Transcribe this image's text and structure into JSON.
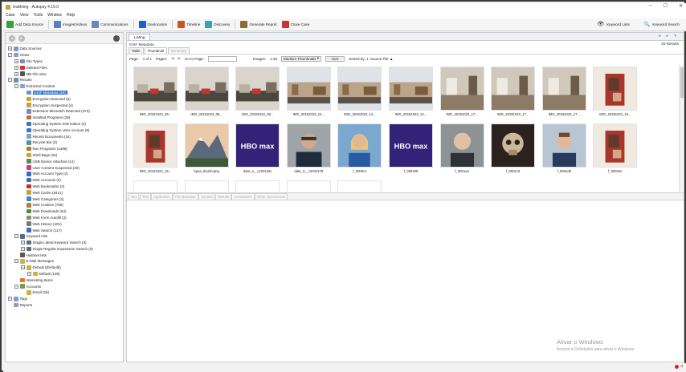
{
  "window": {
    "title": "leakkiing - Autopsy 4.19.0",
    "min": "–",
    "max": "☐",
    "close": "✕"
  },
  "menu": [
    "Case",
    "View",
    "Tools",
    "Window",
    "Help"
  ],
  "toolbar": {
    "items": [
      {
        "label": "Add Data Source",
        "icon": "plus-icon",
        "color": "#3aa13a"
      },
      {
        "label": "Images/Videos",
        "icon": "images-icon",
        "color": "#5b7fc0"
      },
      {
        "label": "Communications",
        "icon": "communications-icon",
        "color": "#6a88b8"
      },
      {
        "label": "Geolocation",
        "icon": "geolocation-icon",
        "color": "#2060c8"
      },
      {
        "label": "Timeline",
        "icon": "timeline-icon",
        "color": "#d0502a"
      },
      {
        "label": "Discovery",
        "icon": "discovery-icon",
        "color": "#3aa0b8"
      },
      {
        "label": "Generate Report",
        "icon": "report-icon",
        "color": "#8a6c3a"
      },
      {
        "label": "Close Case",
        "icon": "close-case-icon",
        "color": "#cc3333"
      }
    ],
    "keyword_lists": "Keyword Lists",
    "keyword_search": "Keyword Search"
  },
  "tree": [
    {
      "label": "Data Sources",
      "level": 0,
      "exp": "+",
      "icon": "#7a9cc8"
    },
    {
      "label": "Views",
      "level": 0,
      "exp": "−",
      "icon": "#8aa0c0"
    },
    {
      "label": "File Types",
      "level": 1,
      "exp": "+",
      "icon": "#7a8fb8"
    },
    {
      "label": "Deleted Files",
      "level": 1,
      "exp": "+",
      "icon": "#cc3333"
    },
    {
      "label": "MB File Size",
      "level": 1,
      "exp": "+",
      "icon": "#555555"
    },
    {
      "label": "Results",
      "level": 0,
      "exp": "−",
      "icon": "#6b8ab8"
    },
    {
      "label": "Extracted Content",
      "level": 1,
      "exp": "−",
      "icon": "#8aa0c0"
    },
    {
      "label": "EXIF Metadata (25)",
      "level": 2,
      "exp": "",
      "icon": "#6a93d6",
      "selected": true
    },
    {
      "label": "Encryption Detected (6)",
      "level": 2,
      "exp": "",
      "icon": "#d0a030"
    },
    {
      "label": "Encryption Suspected (4)",
      "level": 2,
      "exp": "",
      "icon": "#d0a030"
    },
    {
      "label": "Extension Mismatch Detected (373)",
      "level": 2,
      "exp": "",
      "icon": "#6f8fbf"
    },
    {
      "label": "Installed Programs (29)",
      "level": 2,
      "exp": "",
      "icon": "#c07030"
    },
    {
      "label": "Operating System Information (2)",
      "level": 2,
      "exp": "",
      "icon": "#3b74c8"
    },
    {
      "label": "Operating System User Account (8)",
      "level": 2,
      "exp": "",
      "icon": "#3b74c8"
    },
    {
      "label": "Recent Documents (24)",
      "level": 2,
      "exp": "",
      "icon": "#8aa0c0"
    },
    {
      "label": "Recycle Bin (3)",
      "level": 2,
      "exp": "",
      "icon": "#3aa0a0"
    },
    {
      "label": "Run Programs (1486)",
      "level": 2,
      "exp": "",
      "icon": "#c07030"
    },
    {
      "label": "Shell Bags (26)",
      "level": 2,
      "exp": "",
      "icon": "#d0a030"
    },
    {
      "label": "USB Device Attached (14)",
      "level": 2,
      "exp": "",
      "icon": "#5a8a5a"
    },
    {
      "label": "User Content Suspected (20)",
      "level": 2,
      "exp": "",
      "icon": "#c04080"
    },
    {
      "label": "Web Account Type (2)",
      "level": 2,
      "exp": "",
      "icon": "#3a6ac0"
    },
    {
      "label": "Web Accounts (2)",
      "level": 2,
      "exp": "",
      "icon": "#3a6ac0"
    },
    {
      "label": "Web Bookmarks (3)",
      "level": 2,
      "exp": "",
      "icon": "#c03030"
    },
    {
      "label": "Web Cache (8411)",
      "level": 2,
      "exp": "",
      "icon": "#d0a030"
    },
    {
      "label": "Web Categories (2)",
      "level": 2,
      "exp": "",
      "icon": "#3a8ad0"
    },
    {
      "label": "Web Cookies (786)",
      "level": 2,
      "exp": "",
      "icon": "#b08040"
    },
    {
      "label": "Web Downloads (54)",
      "level": 2,
      "exp": "",
      "icon": "#3a9a3a"
    },
    {
      "label": "Web Form Autofill (3)",
      "level": 2,
      "exp": "",
      "icon": "#8a8a8a"
    },
    {
      "label": "Web History (401)",
      "level": 2,
      "exp": "",
      "icon": "#7a7a7a"
    },
    {
      "label": "Web Search (117)",
      "level": 2,
      "exp": "",
      "icon": "#3a6ad0"
    },
    {
      "label": "Keyword Hits",
      "level": 1,
      "exp": "−",
      "icon": "#5a6a8a"
    },
    {
      "label": "Single Literal Keyword Search (0)",
      "level": 2,
      "exp": "+",
      "icon": "#5a6a8a"
    },
    {
      "label": "Single Regular Expression Search (0)",
      "level": 2,
      "exp": "+",
      "icon": "#5a6a8a"
    },
    {
      "label": "Hashset Hits",
      "level": 1,
      "exp": "",
      "icon": "#5a5a5a"
    },
    {
      "label": "E-Mail Messages",
      "level": 1,
      "exp": "−",
      "icon": "#d0b040"
    },
    {
      "label": "Default ([Default])",
      "level": 2,
      "exp": "−",
      "icon": "#d0b040"
    },
    {
      "label": "Default (138)",
      "level": 3,
      "exp": "+",
      "icon": "#d0b040"
    },
    {
      "label": "Interesting Items",
      "level": 1,
      "exp": "",
      "icon": "#e07a20"
    },
    {
      "label": "Accounts",
      "level": 1,
      "exp": "−",
      "icon": "#7a9a4a"
    },
    {
      "label": "Email (26)",
      "level": 2,
      "exp": "",
      "icon": "#d0b040"
    },
    {
      "label": "Tags",
      "level": 0,
      "exp": "+",
      "icon": "#7a9cc8"
    },
    {
      "label": "Reports",
      "level": 0,
      "exp": "",
      "icon": "#8aa0c0"
    }
  ],
  "main": {
    "top_tab": "Listing",
    "tab_controls": "◂ ▸ ▾",
    "section": "EXIF Metadata",
    "result_count": "25 Results",
    "view_tabs": [
      {
        "label": "Table",
        "active": false,
        "disabled": false
      },
      {
        "label": "Thumbnail",
        "active": true,
        "disabled": false
      },
      {
        "label": "Summary",
        "active": false,
        "disabled": true
      }
    ],
    "pager": {
      "page_label": "Page:",
      "page_value": "1 of 1",
      "pages_label": "Pages:",
      "go_label": "Go to Page:",
      "images_label": "Images:",
      "images_value": "1-25",
      "thumb_size": "Medium Thumbnails",
      "sort_button": "Sort",
      "sorted_by": "Sorted by: 1. Source File ▲"
    },
    "thumbnails": [
      {
        "name": "IMG_20191023_09...",
        "kind": "street"
      },
      {
        "name": "IMG_20191023_09...",
        "kind": "street"
      },
      {
        "name": "IMG_20191023_09...",
        "kind": "street"
      },
      {
        "name": "IMG_20191023_14...",
        "kind": "plaza"
      },
      {
        "name": "IMG_20191023_14...",
        "kind": "plaza"
      },
      {
        "name": "IMG_20191023_14...",
        "kind": "plaza"
      },
      {
        "name": "IMG_20191023_17...",
        "kind": "room"
      },
      {
        "name": "IMG_20191023_17...",
        "kind": "room"
      },
      {
        "name": "IMG_20191023_17...",
        "kind": "room"
      },
      {
        "name": "IMG_20191024_15...",
        "kind": "portrait-red"
      },
      {
        "name": "IMG_20191024_15...",
        "kind": "portrait-red"
      },
      {
        "name": "bg1a_thumb.png",
        "kind": "mountain"
      },
      {
        "name": "data_3__c103146c",
        "kind": "hbomax"
      },
      {
        "name": "data_3__c2031478",
        "kind": "man-suit"
      },
      {
        "name": "f_0000c1",
        "kind": "woman-blue"
      },
      {
        "name": "f_000198",
        "kind": "hbomax"
      },
      {
        "name": "f_0001a4",
        "kind": "bald-man"
      },
      {
        "name": "f_0001c9",
        "kind": "skull"
      },
      {
        "name": "f_0001d9",
        "kind": "man-red"
      },
      {
        "name": "f_00022e",
        "kind": "portrait-red"
      }
    ],
    "lower_tabs": [
      "Hex",
      "Text",
      "Application",
      "File Metadata",
      "Context",
      "Results",
      "Annotations",
      "Other Occurrences"
    ]
  },
  "watermark": {
    "line1": "Ativar o Windows",
    "line2": "Acesse a Definições para ativar o Windows."
  },
  "status": {
    "errors": "3"
  }
}
